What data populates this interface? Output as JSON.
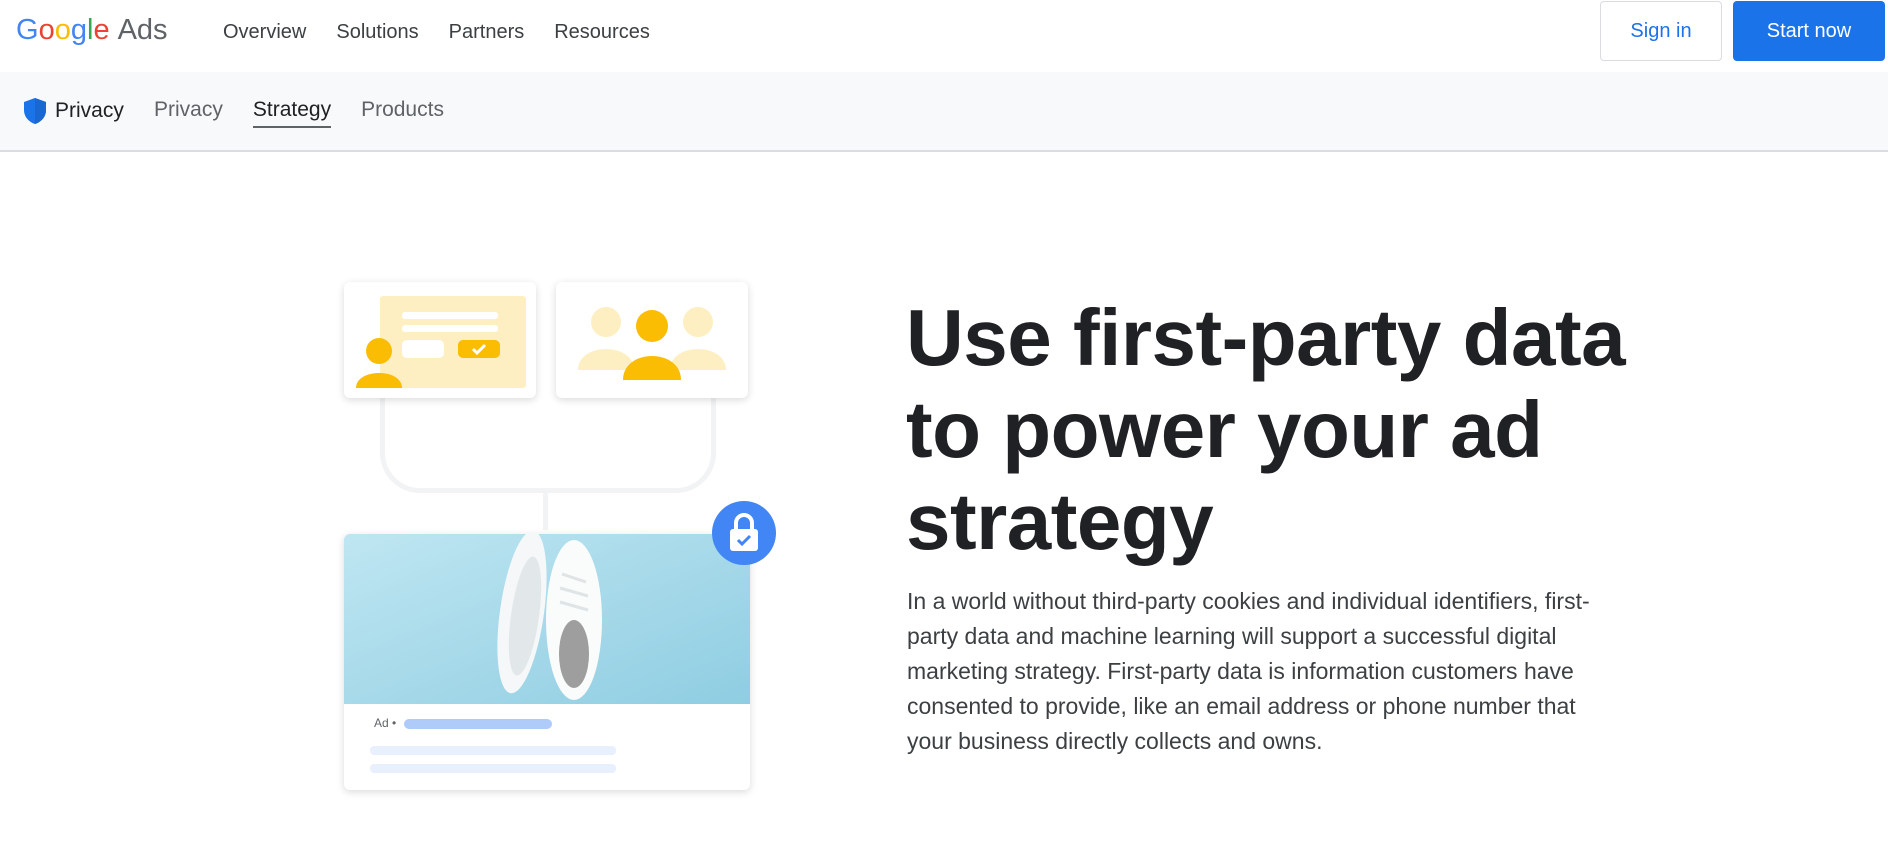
{
  "header": {
    "logo_google": "Google",
    "logo_ads": "Ads",
    "nav": [
      "Overview",
      "Solutions",
      "Partners",
      "Resources"
    ],
    "sign_in": "Sign in",
    "start_now": "Start now"
  },
  "subnav": {
    "brand_label": "Privacy",
    "items": [
      "Privacy",
      "Strategy",
      "Products"
    ],
    "active": "Strategy"
  },
  "hero": {
    "title": "Use first-party data to power your ad strategy",
    "body": "In a world without third-party cookies and individual identifiers, first-party data and machine learning will support a successful digital marketing strategy. First-party data is information customers have consented to provide, like an email address or phone number that your business directly collects and owns."
  },
  "illustration": {
    "ad_label": "Ad •",
    "icons": [
      "shield-icon",
      "lock-check-icon",
      "person-icon",
      "group-icon",
      "check-icon"
    ]
  },
  "colors": {
    "primary_blue": "#1a73e8",
    "accent_yellow": "#fbbc04",
    "light_yellow": "#feefc3",
    "photo_bg": "#a9d9ea",
    "lock_blue": "#4285f4"
  }
}
